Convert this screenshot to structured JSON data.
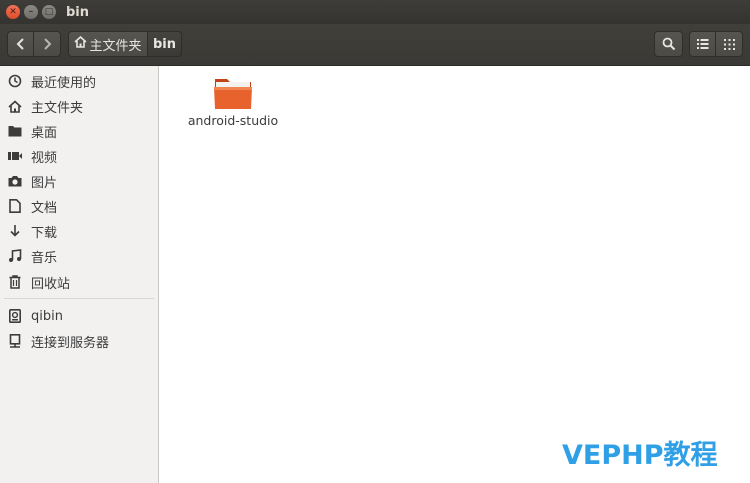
{
  "window": {
    "title": "bin"
  },
  "toolbar": {
    "breadcrumb_home": "主文件夹",
    "breadcrumb_current": "bin"
  },
  "sidebar": {
    "items": [
      {
        "label": "最近使用的",
        "icon": "clock-icon"
      },
      {
        "label": "主文件夹",
        "icon": "home-icon"
      },
      {
        "label": "桌面",
        "icon": "folder-icon"
      },
      {
        "label": "视频",
        "icon": "video-icon"
      },
      {
        "label": "图片",
        "icon": "camera-icon"
      },
      {
        "label": "文档",
        "icon": "document-icon"
      },
      {
        "label": "下载",
        "icon": "download-icon"
      },
      {
        "label": "音乐",
        "icon": "music-icon"
      },
      {
        "label": "回收站",
        "icon": "trash-icon"
      },
      {
        "label": "qibin",
        "icon": "drive-icon"
      },
      {
        "label": "连接到服务器",
        "icon": "server-icon"
      }
    ]
  },
  "main": {
    "files": [
      {
        "name": "android-studio",
        "type": "folder"
      }
    ]
  },
  "watermark": "VEPHP教程",
  "colors": {
    "folder_orange": "#e8622d",
    "close_button": "#e95f3c",
    "watermark": "#2fa0e6"
  }
}
